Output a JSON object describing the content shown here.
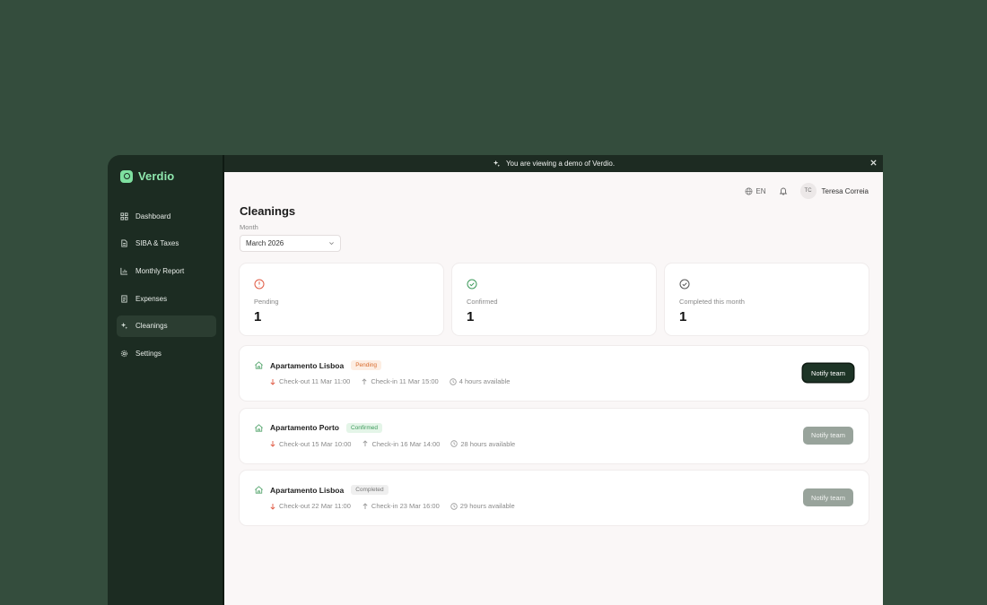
{
  "app": {
    "name": "Verdio"
  },
  "sidebar": {
    "items": [
      {
        "label": "Dashboard",
        "icon": "dashboard-icon"
      },
      {
        "label": "SIBA & Taxes",
        "icon": "document-icon"
      },
      {
        "label": "Monthly Report",
        "icon": "bar-chart-icon"
      },
      {
        "label": "Expenses",
        "icon": "receipt-icon"
      },
      {
        "label": "Cleanings",
        "icon": "sparkle-icon",
        "active": true
      },
      {
        "label": "Settings",
        "icon": "gear-icon"
      }
    ]
  },
  "banner": {
    "text": "You are viewing a demo of Verdio."
  },
  "topbar": {
    "language": "EN",
    "user_initials": "TC",
    "user_name": "Teresa Correia"
  },
  "page": {
    "title": "Cleanings",
    "month_label": "Month",
    "month_value": "March 2026"
  },
  "stats": [
    {
      "label": "Pending",
      "value": "1",
      "color": "#e05a43",
      "icon": "alert-circle-icon"
    },
    {
      "label": "Confirmed",
      "value": "1",
      "color": "#3d9a5b",
      "icon": "check-circle-icon"
    },
    {
      "label": "Completed this month",
      "value": "1",
      "color": "#555555",
      "icon": "check-circle-icon"
    }
  ],
  "cleanings": [
    {
      "property": "Apartamento Lisboa",
      "status": "Pending",
      "checkout": "Check-out 11 Mar 11:00",
      "checkin": "Check-in 11 Mar 15:00",
      "available": "4 hours available",
      "button": "Notify team",
      "button_enabled": true
    },
    {
      "property": "Apartamento Porto",
      "status": "Confirmed",
      "checkout": "Check-out 15 Mar 10:00",
      "checkin": "Check-in 16 Mar 14:00",
      "available": "28 hours available",
      "button": "Notify team",
      "button_enabled": false
    },
    {
      "property": "Apartamento Lisboa",
      "status": "Completed",
      "checkout": "Check-out 22 Mar 11:00",
      "checkin": "Check-in 23 Mar 16:00",
      "available": "29 hours available",
      "button": "Notify team",
      "button_enabled": false
    }
  ]
}
